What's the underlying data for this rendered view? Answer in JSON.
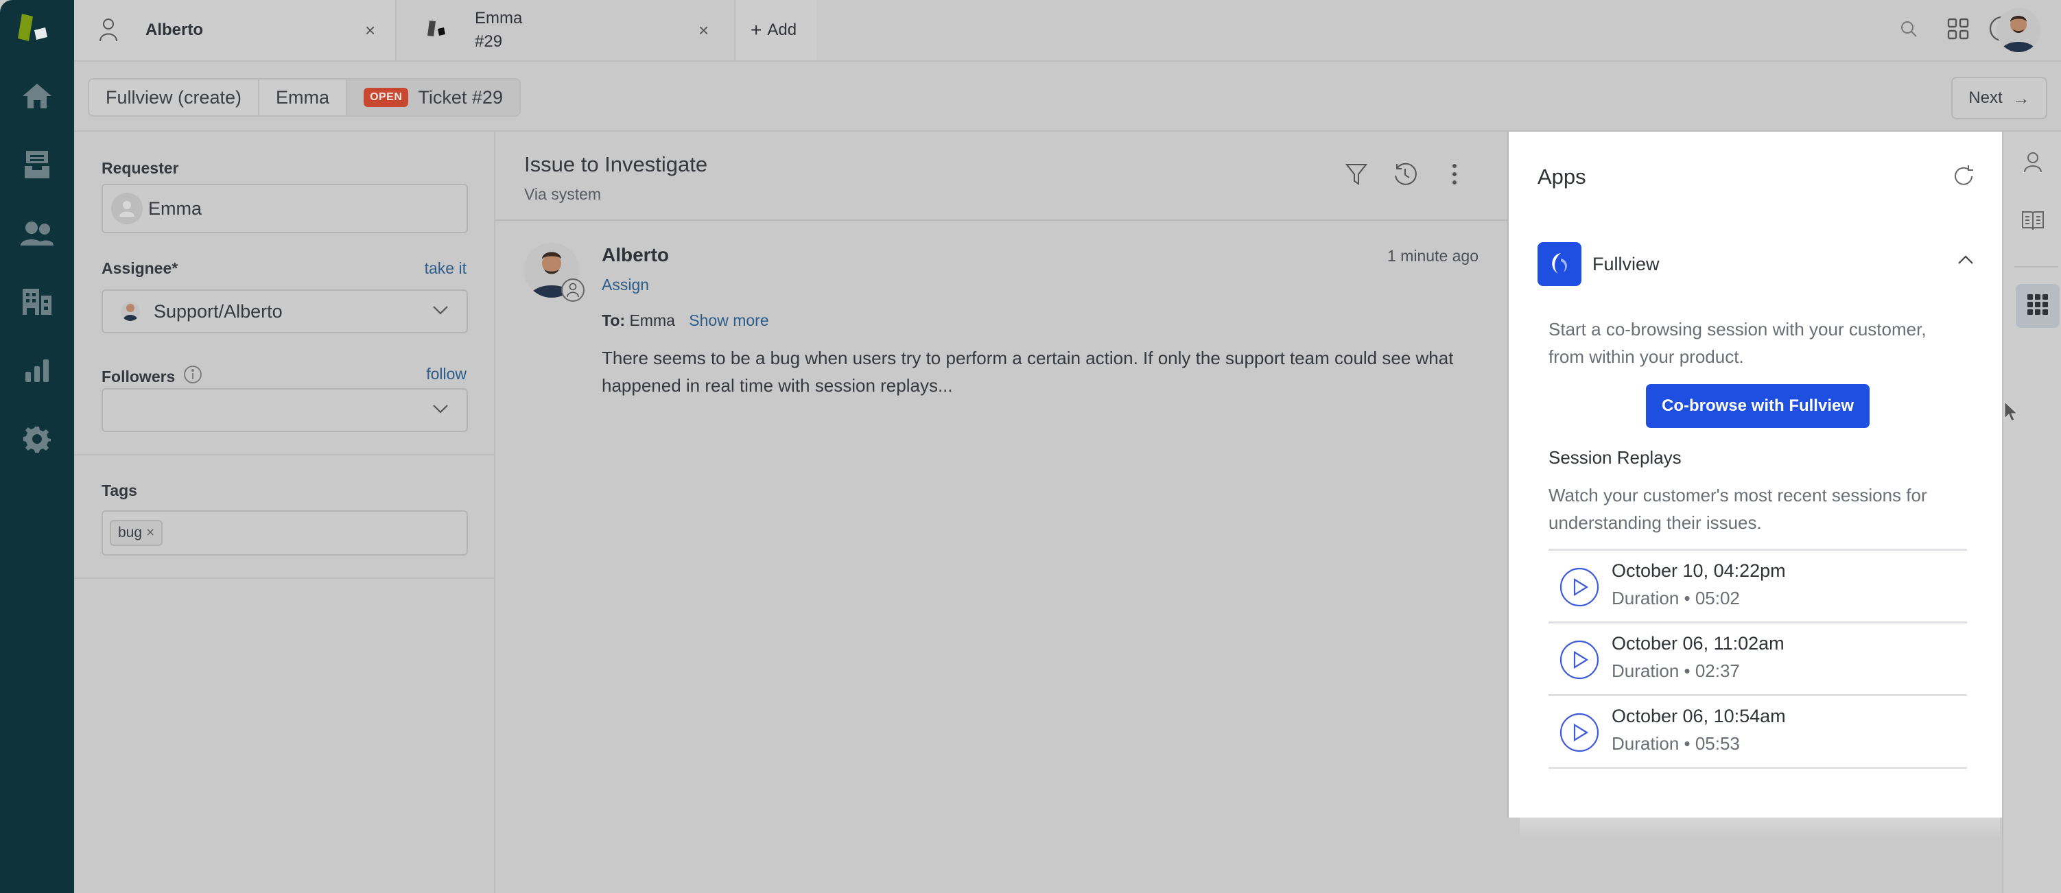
{
  "nav": {
    "items": [
      {
        "name": "home",
        "icon": "home-icon"
      },
      {
        "name": "views",
        "icon": "inbox-icon"
      },
      {
        "name": "customers",
        "icon": "users-icon"
      },
      {
        "name": "organizations",
        "icon": "building-icon"
      },
      {
        "name": "reporting",
        "icon": "bar-chart-icon"
      },
      {
        "name": "admin",
        "icon": "gear-icon"
      }
    ]
  },
  "tabs": [
    {
      "label": "Alberto",
      "icon": "user-icon",
      "active": false
    },
    {
      "label_line1": "Emma",
      "label_line2": "#29",
      "icon": "ticket-icon",
      "active": true
    }
  ],
  "add_tab": {
    "label": "Add"
  },
  "topbar": {
    "icons": [
      "search-icon",
      "apps-grid-icon",
      "help-icon",
      "user-avatar"
    ]
  },
  "breadcrumb": {
    "items": [
      "Fullview (create)",
      "Emma",
      "Ticket #29"
    ],
    "status_badge": "OPEN"
  },
  "next_button": {
    "label": "Next"
  },
  "ticket_fields": {
    "requester": {
      "label": "Requester",
      "value": "Emma"
    },
    "assignee": {
      "label": "Assignee*",
      "link": "take it",
      "value": "Support/Alberto"
    },
    "followers": {
      "label": "Followers",
      "link": "follow",
      "value": ""
    },
    "tags": {
      "label": "Tags",
      "values": [
        "bug"
      ]
    }
  },
  "conversation": {
    "title": "Issue to Investigate",
    "subtitle": "Via system",
    "messages": [
      {
        "author": "Alberto",
        "time": "1 minute ago",
        "assign_link": "Assign",
        "to_label": "To:",
        "to_value": "Emma",
        "show_more": "Show more",
        "body": "There seems to be a bug when users try to perform a certain action. If only the support team could see what happened in real time with session replays..."
      }
    ]
  },
  "apps_panel": {
    "title": "Apps",
    "app": {
      "name": "Fullview",
      "description": "Start a co-browsing session with your customer, from within your product.",
      "cobrowse_button": "Co-browse with Fullview",
      "session_replays": {
        "title": "Session Replays",
        "description": "Watch your customer's most recent sessions for understanding their issues.",
        "items": [
          {
            "date": "October 10, 04:22pm",
            "duration": "Duration • 05:02"
          },
          {
            "date": "October 06, 11:02am",
            "duration": "Duration • 02:37"
          },
          {
            "date": "October 06, 10:54am",
            "duration": "Duration • 05:53"
          }
        ]
      }
    }
  },
  "colors": {
    "nav_bg": "#0f333b",
    "accent_blue": "#1f4fe0",
    "link_blue": "#2b5c8a",
    "open_badge": "#c8472f",
    "page_bg": "#c9c9c9"
  }
}
